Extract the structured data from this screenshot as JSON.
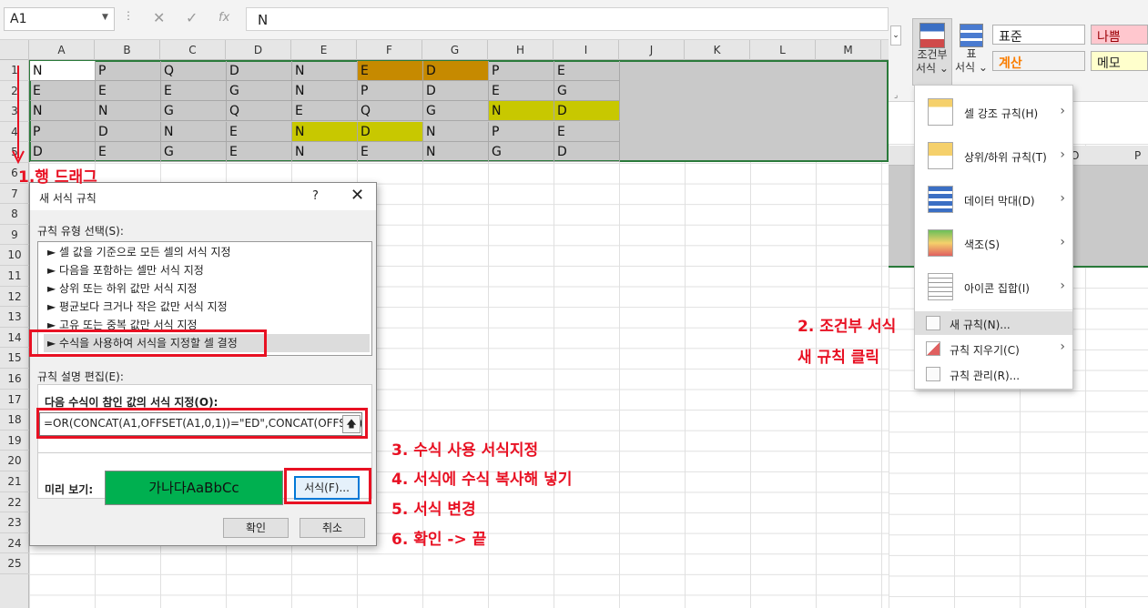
{
  "formula_bar": {
    "name_box": "A1",
    "fx": "fx",
    "cancel": "✕",
    "enter": "✓",
    "formula": "N"
  },
  "columns": [
    "A",
    "B",
    "C",
    "D",
    "E",
    "F",
    "G",
    "H",
    "I",
    "J",
    "K",
    "L",
    "M"
  ],
  "rows": [
    "1",
    "2",
    "3",
    "4",
    "5",
    "6",
    "7",
    "8",
    "9",
    "10",
    "11",
    "12",
    "13",
    "14",
    "15",
    "16",
    "17",
    "18",
    "19",
    "20",
    "21",
    "22",
    "23",
    "24",
    "25"
  ],
  "cells": [
    [
      "N",
      "P",
      "Q",
      "D",
      "N",
      "E",
      "D",
      "P",
      "E"
    ],
    [
      "E",
      "E",
      "E",
      "G",
      "N",
      "P",
      "D",
      "E",
      "G"
    ],
    [
      "N",
      "N",
      "G",
      "Q",
      "E",
      "Q",
      "G",
      "N",
      "D"
    ],
    [
      "P",
      "D",
      "N",
      "E",
      "N",
      "D",
      "N",
      "P",
      "E"
    ],
    [
      "D",
      "E",
      "G",
      "E",
      "N",
      "E",
      "N",
      "G",
      "D"
    ]
  ],
  "highlight_colors": {
    "orange": "#c68a00",
    "yellow": "#c8c800",
    "green": "#00b050",
    "annotation_red": "#e81123"
  },
  "ribbon": {
    "cond_format": "조건부",
    "cond_format2": "서식 ⌄",
    "table": "표",
    "table2": "서식 ⌄",
    "style_normal": "표준",
    "style_bad": "나쁨",
    "style_calc": "계산",
    "style_memo": "메모"
  },
  "right_grid": {
    "col_o": "O",
    "col_p": "P"
  },
  "menu": {
    "items": [
      {
        "label": "셀 강조 규칙(H)"
      },
      {
        "label": "상위/하위 규칙(T)"
      },
      {
        "label": "데이터 막대(D)"
      },
      {
        "label": "색조(S)"
      },
      {
        "label": "아이콘 집합(I)"
      }
    ],
    "new_rule": "새 규칙(N)...",
    "clear_rules": "규칙 지우기(C)",
    "manage_rules": "규칙 관리(R)..."
  },
  "dialog": {
    "title": "새 서식 규칙",
    "help": "?",
    "close": "✕",
    "select_type_label": "규칙 유형 선택(S):",
    "rule_types": [
      "► 셀 값을 기준으로 모든 셀의 서식 지정",
      "► 다음을 포함하는 셀만 서식 지정",
      "► 상위 또는 하위 값만 서식 지정",
      "► 평균보다 크거나 작은 값만 서식 지정",
      "► 고유 또는 중복 값만 서식 지정",
      "► 수식을 사용하여 서식을 지정할 셀 결정"
    ],
    "edit_label": "규칙 설명 편집(E):",
    "formula_label": "다음 수식이 참인 값의 서식 지정(O):",
    "formula": "=OR(CONCAT(A1,OFFSET(A1,0,1))=\"ED\",CONCAT(OFFSET(A",
    "preview_label": "미리 보기:",
    "preview_text": "가나다AaBbCc",
    "format_button": "서식(F)...",
    "ok": "확인",
    "cancel": "취소"
  },
  "annotations": {
    "step1": "1.행 드래그",
    "step2a": "2. 조건부 서식",
    "step2b": "새 규칙 클릭",
    "step3": "3. 수식 사용 서식지정",
    "step4": "4. 서식에 수식 복사해 넣기",
    "step5": "5. 서식 변경",
    "step6": "6. 확인 -> 끝"
  }
}
